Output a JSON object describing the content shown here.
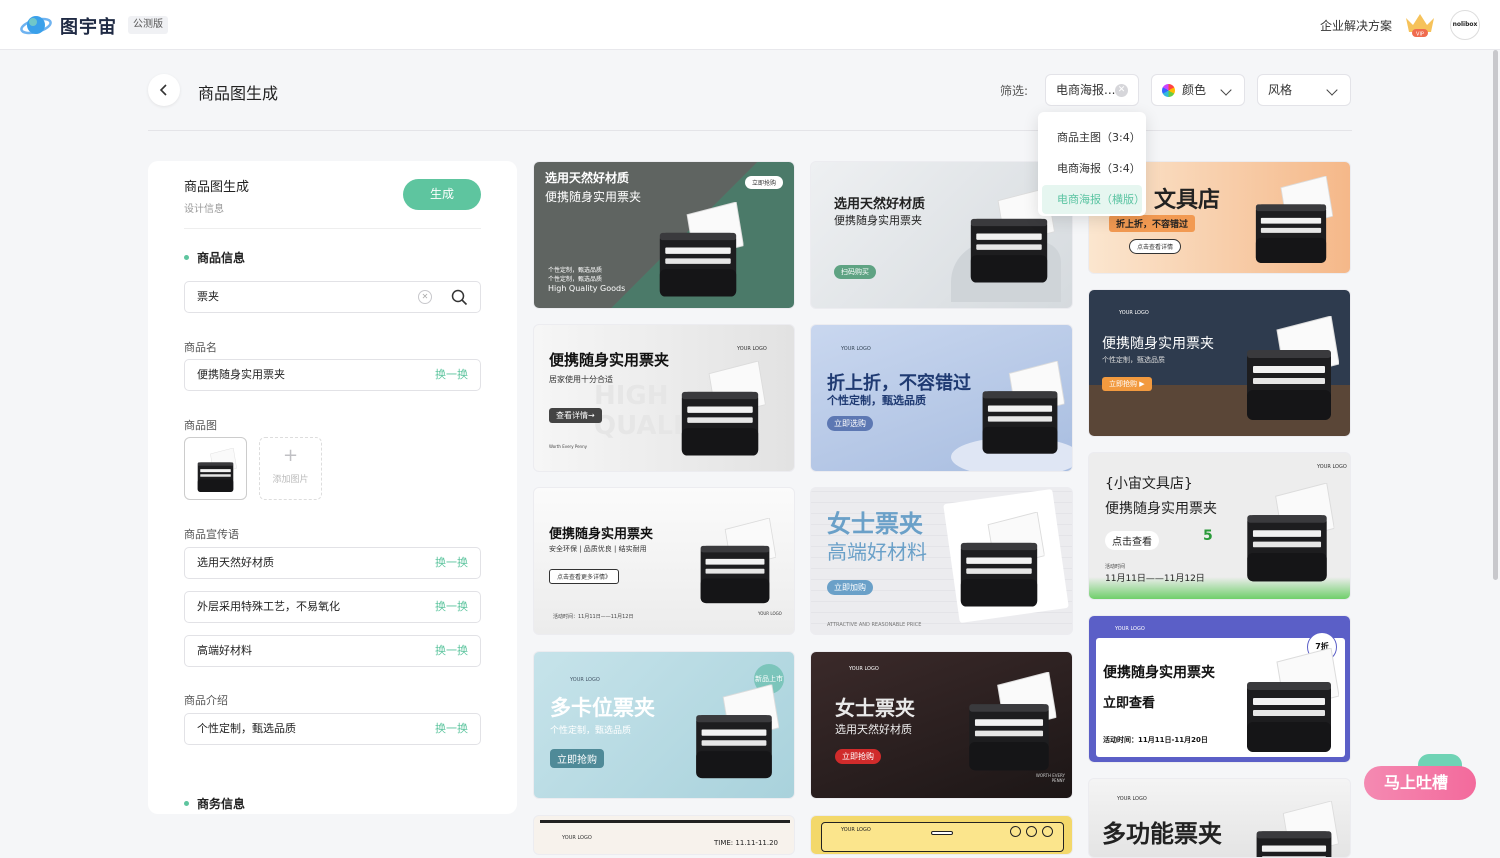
{
  "header": {
    "brand": "图宇宙",
    "badge": "公测版",
    "enterprise_link": "企业解决方案",
    "vip_label": "VIP",
    "avatar_text": "nolibox"
  },
  "toolbar": {
    "page_title": "商品图生成",
    "filter_label": "筛选:",
    "type_filter_value": "电商海报...",
    "color_filter_label": "颜色",
    "style_filter_label": "风格"
  },
  "type_dropdown": {
    "options": [
      "商品主图（3:4）",
      "电商海报（3:4）",
      "电商海报（横版）"
    ],
    "selected_index": 2
  },
  "form": {
    "title": "商品图生成",
    "subtitle": "设计信息",
    "generate_label": "生成",
    "section_product": "商品信息",
    "search_value": "票夹",
    "name_label": "商品名",
    "name_value": "便携随身实用票夹",
    "swap_label": "换一换",
    "image_label": "商品图",
    "add_image_label": "添加图片",
    "slogan_label": "商品宣传语",
    "slogans": [
      "选用天然好材质",
      "外层采用特殊工艺，不易氧化",
      "高端好材料"
    ],
    "intro_label": "商品介绍",
    "intro_value": "个性定制，甄选品质",
    "section_business": "商务信息"
  },
  "cards": {
    "c1": {
      "title": "选用天然好材质",
      "sub": "便携随身实用票夹",
      "btn": "立即抢购",
      "l1": "个性定制，甄选品质",
      "l2": "个性定制，甄选品质",
      "l3": "High Quality Goods"
    },
    "c2": {
      "title": "选用天然好材质",
      "sub": "便携随身实用票夹",
      "btn": "扫码购买"
    },
    "c3": {
      "title": "文具店",
      "sub": "折上折，不容错过",
      "btn": "点击查看详情"
    },
    "c4": {
      "title": "便携随身实用票夹",
      "sub": "居家使用十分合适",
      "btn": "查看详情→",
      "logo": "YOUR LOGO",
      "foot": "Worth Every Penny",
      "bg": "HIGH QUALITY"
    },
    "c5": {
      "title": "折上折，不容错过",
      "sub": "个性定制，甄选品质",
      "btn": "立即选购",
      "logo": "YOUR LOGO"
    },
    "c6": {
      "title": "便携随身实用票夹",
      "sub": "个性定制，甄选品质",
      "btn": "立即抢购 ▶",
      "logo": "YOUR LOGO"
    },
    "c7": {
      "title": "便携随身实用票夹",
      "sub": "安全环保 | 品质优良 | 结实耐用",
      "btn": "点击查看更多详情》",
      "foot": "活动时间：11月11日——11月12日",
      "logo": "YOUR LOGO"
    },
    "c8": {
      "title": "女士票夹",
      "sub": "高端好材料",
      "btn": "立即加购",
      "foot": "ATTRACTIVE AND REASONABLE PRICE"
    },
    "c9": {
      "title": "{小宙文具店}",
      "sub": "便携随身实用票夹",
      "btn": "点击查看",
      "num": "5",
      "foot1": "活动时间",
      "foot2": "11月11日——11月12日",
      "logo": "YOUR LOGO"
    },
    "c10": {
      "title": "多卡位票夹",
      "sub": "个性定制，甄选品质",
      "btn": "立即抢购",
      "badge": "新品上市",
      "logo": "YOUR LOGO"
    },
    "c11": {
      "title": "女士票夹",
      "sub": "选用天然好材质",
      "btn": "立即抢购",
      "foot": "WORTH EVERY PENNY",
      "logo": "YOUR LOGO"
    },
    "c12": {
      "title": "便携随身实用票夹",
      "sub": "立即查看",
      "foot": "活动时间：11月11日-11月20日",
      "badge": "7折",
      "logo": "YOUR LOGO"
    },
    "c13": {
      "logo": "YOUR LOGO",
      "time": "TIME: 11.11-11.20"
    },
    "c14": {
      "logo": "YOUR LOGO"
    },
    "c15": {
      "title": "多功能票夹",
      "logo": "YOUR LOGO"
    }
  },
  "feedback": {
    "label": "马上吐槽"
  }
}
